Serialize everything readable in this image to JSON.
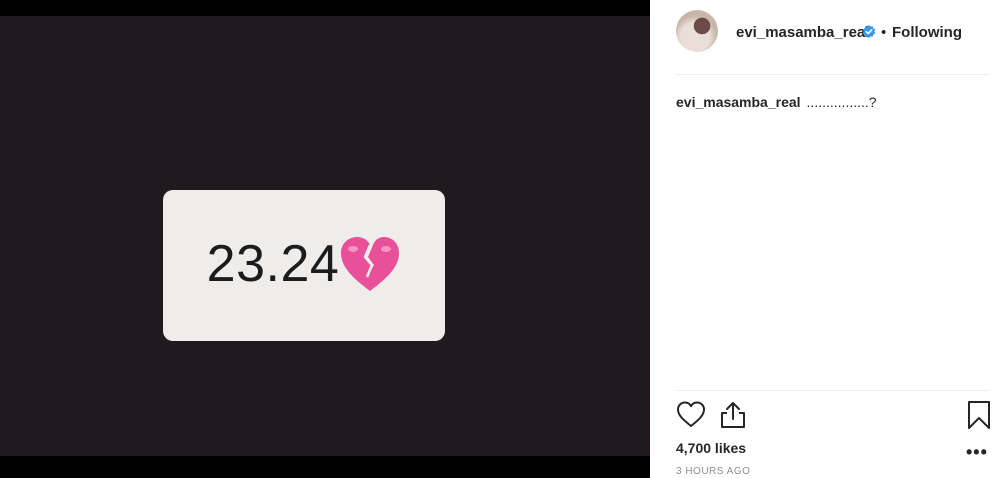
{
  "post": {
    "username": "evi_masamba_real",
    "separator": "•",
    "follow_label": "Following",
    "image_text": "23.24",
    "caption_user": "evi_masamba_real",
    "caption_text": "................?",
    "likes": "4,700 likes",
    "more_label": "•••",
    "timestamp": "3 HOURS AGO"
  },
  "icons": {
    "verified": "verified-badge-icon",
    "like": "heart-icon",
    "share": "share-icon",
    "save": "bookmark-icon",
    "emoji": "broken-heart-icon"
  },
  "colors": {
    "photo_background": "#201a1f",
    "card_background": "#efedec",
    "verified_blue": "#3897f0",
    "broken_heart_pink": "#e8509a"
  }
}
